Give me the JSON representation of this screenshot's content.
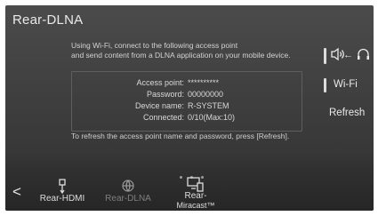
{
  "screen": {
    "title": "Rear-DLNA",
    "message_line1": "Using Wi-Fi, connect to the following access point",
    "message_line2": "and send content from a DLNA application on your mobile device.",
    "info": [
      {
        "label": "Access point:",
        "value": "**********"
      },
      {
        "label": "Password:",
        "value": "00000000"
      },
      {
        "label": "Device name:",
        "value": "R-SYSTEM"
      },
      {
        "label": "Connected:",
        "value": "0/10(Max:10)"
      }
    ],
    "hint": "To refresh the access point name and password, press [Refresh]."
  },
  "side": {
    "audio_label": "←",
    "wifi_label": "Wi-Fi",
    "refresh_label": "Refresh"
  },
  "nav": {
    "back_label": "<",
    "items": [
      {
        "label": "Rear-HDMI",
        "icon": "usb-icon"
      },
      {
        "label": "Rear-DLNA",
        "icon": "dlna-icon"
      },
      {
        "label": "Rear-",
        "label2": "Miracast™",
        "icon": "miracast-icon"
      }
    ]
  }
}
